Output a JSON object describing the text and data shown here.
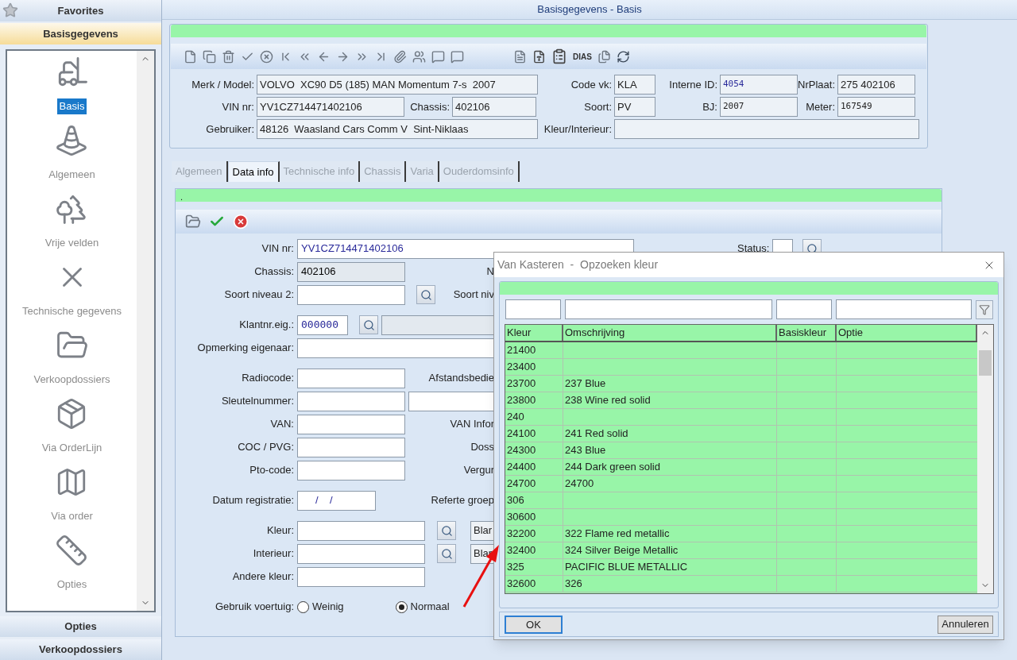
{
  "window": {
    "title": "Basisgegevens - Basis"
  },
  "sidebar": {
    "top_sections": [
      {
        "label": "Favorites",
        "selected": false
      },
      {
        "label": "Basisgegevens",
        "selected": true
      }
    ],
    "items": [
      {
        "label": "Basis",
        "selected": true
      },
      {
        "label": "Algemeen",
        "selected": false
      },
      {
        "label": "Vrije velden",
        "selected": false
      },
      {
        "label": "Technische gegevens",
        "selected": false
      },
      {
        "label": "Verkoopdossiers",
        "selected": false
      },
      {
        "label": "Via OrderLijn",
        "selected": false
      },
      {
        "label": "Via order",
        "selected": false
      },
      {
        "label": "Opties",
        "selected": false
      }
    ],
    "bottom_sections": [
      {
        "label": "Opties"
      },
      {
        "label": "Verkoopdossiers"
      }
    ]
  },
  "header": {
    "toolbar_text": "DIAS",
    "left_rows": [
      [
        {
          "label": "Merk / Model:",
          "value": "VOLVO  XC90 D5 (185) MAN Momentum 7-s  2007",
          "kind": "text"
        }
      ],
      [
        {
          "label": "VIN nr:",
          "value": "YV1CZ714471402106",
          "kind": "text"
        },
        {
          "label": "Chassis:",
          "value": "402106",
          "kind": "text"
        }
      ],
      [
        {
          "label": "Gebruiker:",
          "value": "48126  Waasland Cars Comm V  Sint-Niklaas",
          "kind": "text"
        }
      ]
    ],
    "right_rows": [
      [
        {
          "label": "Code vk:",
          "value": "KLA",
          "kind": "text"
        },
        {
          "label": "Interne ID:",
          "value": "4054",
          "kind": "id"
        },
        {
          "label": "NrPlaat:",
          "value": "275 402106",
          "kind": "text"
        }
      ],
      [
        {
          "label": "Soort:",
          "value": "PV",
          "kind": "text"
        },
        {
          "label": "BJ:",
          "value": "2007",
          "kind": "number"
        },
        {
          "label": "Meter:",
          "value": "167549",
          "kind": "number"
        }
      ],
      [
        {
          "label": "Kleur/Interieur:",
          "kind": "text"
        }
      ]
    ]
  },
  "tabs": [
    {
      "label": "Algemeen",
      "selected": false
    },
    {
      "label": "Data info",
      "selected": true
    },
    {
      "label": "Technische info",
      "selected": false
    },
    {
      "label": "Chassis",
      "selected": false
    },
    {
      "label": "Varia",
      "selected": false
    },
    {
      "label": "Ouderdomsinfo",
      "selected": false
    }
  ],
  "form": {
    "status_text": ".",
    "vin": {
      "label": "VIN nr:",
      "value": "YV1CZ714471402106"
    },
    "status_label": "Status:",
    "rows": [
      {
        "kind": "readonly",
        "label": "Chassis:",
        "value": "402106",
        "side_label": "N"
      },
      {
        "kind": "lookup",
        "label": "Soort niveau 2:",
        "side_label": "Soort niv"
      },
      {
        "kind": "customer",
        "label": "Klantnr.eig.:",
        "value": "000000"
      },
      {
        "kind": "wide",
        "label": "Opmerking eigenaar:"
      },
      {
        "kind": "plain",
        "label": "Radiocode:",
        "side_label": "Afstandsbedie"
      },
      {
        "kind": "double",
        "label": "Sleutelnummer:"
      },
      {
        "kind": "plain",
        "label": "VAN:",
        "side_label": "VAN Infor"
      },
      {
        "kind": "plain",
        "label": "COC / PVG:",
        "side_label": "Doss"
      },
      {
        "kind": "plain",
        "label": "Pto-code:",
        "side_label": "Vergur"
      },
      {
        "kind": "date",
        "label": "Datum registratie:",
        "value": "/    /",
        "side_label": "Referte groep"
      },
      {
        "kind": "color",
        "label": "Kleur:",
        "button": "Blar"
      },
      {
        "kind": "color",
        "label": "Interieur:",
        "button": "Blar"
      },
      {
        "kind": "medium",
        "label": "Andere kleur:"
      },
      {
        "kind": "radio",
        "label": "Gebruik voertuig:",
        "options": [
          {
            "label": "Weinig",
            "selected": false
          },
          {
            "label": "Normaal",
            "selected": true
          }
        ]
      }
    ]
  },
  "dialog": {
    "title": "Van Kasteren  -  Opzoeken kleur",
    "columns": [
      "Kleur",
      "Omschrijving",
      "Basiskleur",
      "Optie"
    ],
    "rows": [
      {
        "kleur": "21400"
      },
      {
        "kleur": "23400"
      },
      {
        "kleur": "23700",
        "omschrijving": "237 Blue"
      },
      {
        "kleur": "23800",
        "omschrijving": "238 Wine red solid"
      },
      {
        "kleur": "240"
      },
      {
        "kleur": "24100",
        "omschrijving": "241 Red solid"
      },
      {
        "kleur": "24300",
        "omschrijving": "243 Blue"
      },
      {
        "kleur": "24400",
        "omschrijving": "244 Dark green solid"
      },
      {
        "kleur": "24700",
        "omschrijving": "24700"
      },
      {
        "kleur": "306"
      },
      {
        "kleur": "30600"
      },
      {
        "kleur": "32200",
        "omschrijving": "322 Flame red metallic"
      },
      {
        "kleur": "32400",
        "omschrijving": "324 Silver Beige Metallic"
      },
      {
        "kleur": "325",
        "omschrijving": "PACIFIC BLUE METALLIC"
      },
      {
        "kleur": "32600",
        "omschrijving": "326"
      }
    ],
    "ok": "OK",
    "cancel": "Annuleren"
  }
}
